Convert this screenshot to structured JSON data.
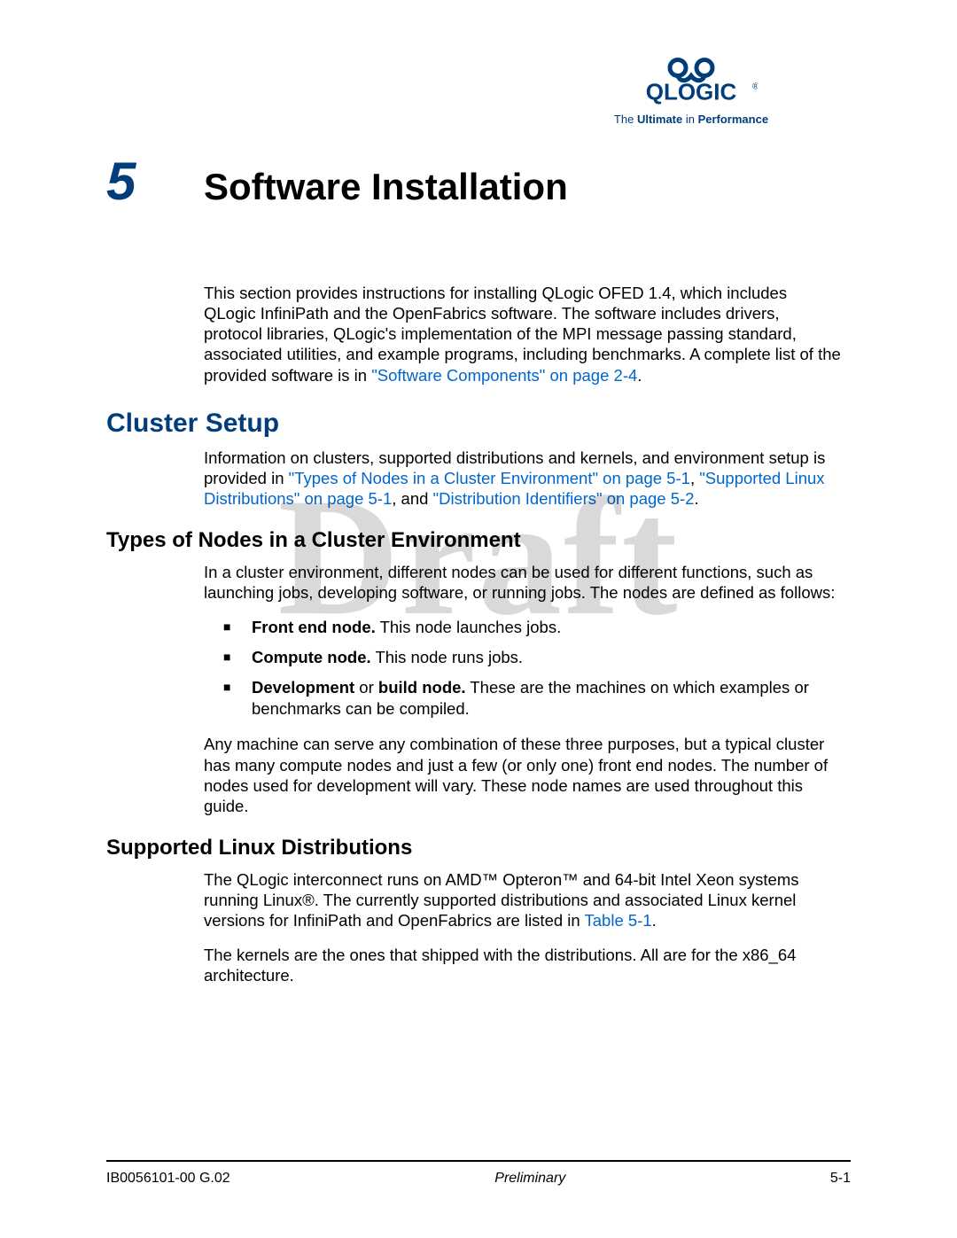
{
  "logo": {
    "brand": "QLOGIC",
    "tagline_pre": "The ",
    "tagline_bold1": "Ultimate",
    "tagline_mid": " in ",
    "tagline_bold2": "Performance"
  },
  "chapter": {
    "number": "5",
    "title": "Software Installation"
  },
  "intro": {
    "text_pre": "This section provides instructions for installing QLogic OFED 1.4, which includes QLogic InfiniPath and the OpenFabrics software. The software includes drivers, protocol libraries, QLogic's implementation of the MPI message passing standard, associated utilities, and example programs, including benchmarks. A complete list of the provided software is in ",
    "link": "\"Software Components\" on page 2-4",
    "text_post": "."
  },
  "cluster_setup": {
    "heading": "Cluster Setup",
    "para_pre": "Information on clusters, supported distributions and kernels, and environment setup is provided in ",
    "link1": "\"Types of Nodes in a Cluster Environment\" on page 5-1",
    "sep1": ", ",
    "link2": "\"Supported Linux Distributions\" on page 5-1",
    "sep2": ", and ",
    "link3": "\"Distribution Identifiers\" on page 5-2",
    "para_post": "."
  },
  "types_nodes": {
    "heading": "Types of Nodes in a Cluster Environment",
    "intro": "In a cluster environment, different nodes can be used for different functions, such as launching jobs, developing software, or running jobs. The nodes are defined as follows:",
    "bullets": [
      {
        "bold": "Front end node.",
        "rest": " This node launches jobs."
      },
      {
        "bold": "Compute node.",
        "rest": " This node runs jobs."
      },
      {
        "bold": "Development",
        "mid": " or ",
        "bold2": "build node.",
        "rest": " These are the machines on which examples or benchmarks can be compiled."
      }
    ],
    "outro": "Any machine can serve any combination of these three purposes, but a typical cluster has many compute nodes and just a few (or only one) front end nodes. The number of nodes used for development will vary. These node names are used throughout this guide."
  },
  "supported_distros": {
    "heading": "Supported Linux Distributions",
    "para1_pre": "The QLogic interconnect runs on AMD™ Opteron™ and 64-bit Intel Xeon systems running Linux®. The currently supported distributions and associated Linux kernel versions for InfiniPath and OpenFabrics are listed in ",
    "para1_link": "Table 5-1",
    "para1_post": ".",
    "para2": "The kernels are the ones that shipped with the distributions. All are for the x86_64 architecture."
  },
  "watermark": "Draft",
  "footer": {
    "left": "IB0056101-00 G.02",
    "center": "Preliminary",
    "right": "5-1"
  }
}
